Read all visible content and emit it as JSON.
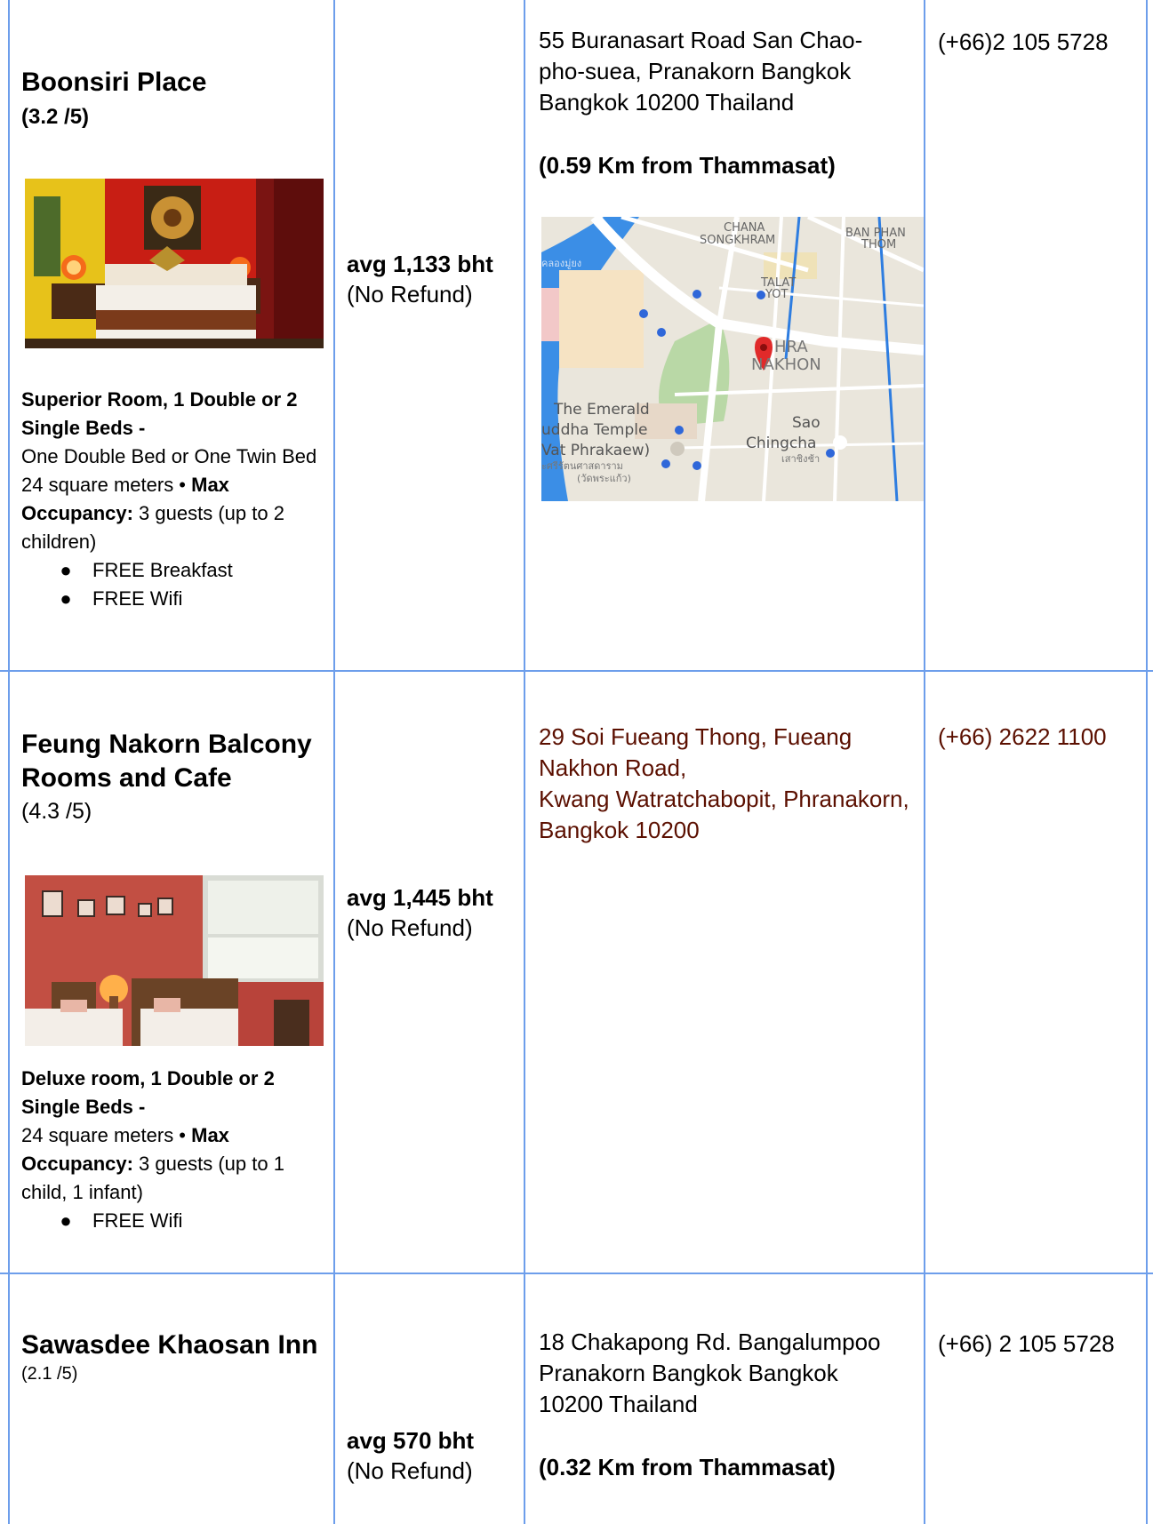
{
  "hotels": [
    {
      "name": "Boonsiri Place",
      "rating": "(3.2 /5)",
      "room_title": "Superior Room, 1 Double or 2 Single Beds -",
      "room_bed": "One Double Bed or One Twin Bed",
      "size_text": "24 square meters • ",
      "max_label": "Max Occupancy:",
      "occupancy": " 3 guests (up to 2 children)",
      "amenities": [
        "FREE Breakfast",
        "FREE Wifi"
      ],
      "price": "avg 1,133 bht",
      "refund": "(No Refund)",
      "address": "55 Buranasart Road San Chao-pho-suea, Pranakorn Bangkok Bangkok 10200 Thailand",
      "distance": "(0.59 Km from Thammasat)",
      "phone": "(+66)2 105 5728",
      "map_labels": {
        "chana": "CHANA",
        "songkhram": "SONGKHRAM",
        "ban_phan": "BAN PHAN",
        "thom": "THOM",
        "talat": "TALAT",
        "yot": "YOT",
        "phra": "HRA",
        "nakhon": "NAKHON",
        "emerald1": "The Emerald",
        "emerald2": "uddha Temple",
        "emerald3": "Vat Phrakaew)",
        "emerald_th1": "ะศรีรัตนศาสดาราม",
        "emerald_th2": "(วัดพระแก้ว)",
        "sao": "Sao",
        "chingcha": "Chingcha",
        "sao_th": "เสาชิงช้า",
        "river_th": "คลองมู่ยง"
      }
    },
    {
      "name": "Feung Nakorn Balcony Rooms and Cafe",
      "rating": "(4.3 /5)",
      "room_title": "Deluxe room, 1 Double or 2 Single Beds -",
      "size_text": "24 square meters • ",
      "max_label": "Max Occupancy:",
      "occupancy": " 3 guests (up to 1 child, 1 infant)",
      "amenities": [
        "FREE Wifi"
      ],
      "price": "avg 1,445 bht",
      "refund": "(No Refund)",
      "address_lines": [
        "29 Soi Fueang Thong, Fueang Nakhon Road,",
        "Kwang Watratchabopit, Phranakorn, Bangkok 10200"
      ],
      "phone": "(+66) 2622 1100"
    },
    {
      "name": "Sawasdee Khaosan Inn",
      "rating": "(2.1 /5)",
      "price": "avg 570 bht",
      "refund": "(No Refund)",
      "address": "18 Chakapong Rd. Bangalumpoo Pranakorn Bangkok Bangkok 10200 Thailand",
      "distance": "(0.32 Km from Thammasat)",
      "phone": "(+66) 2 105 5728"
    }
  ],
  "colors": {
    "border": "#6d9eeb",
    "dark_red": "#5b0f00"
  }
}
